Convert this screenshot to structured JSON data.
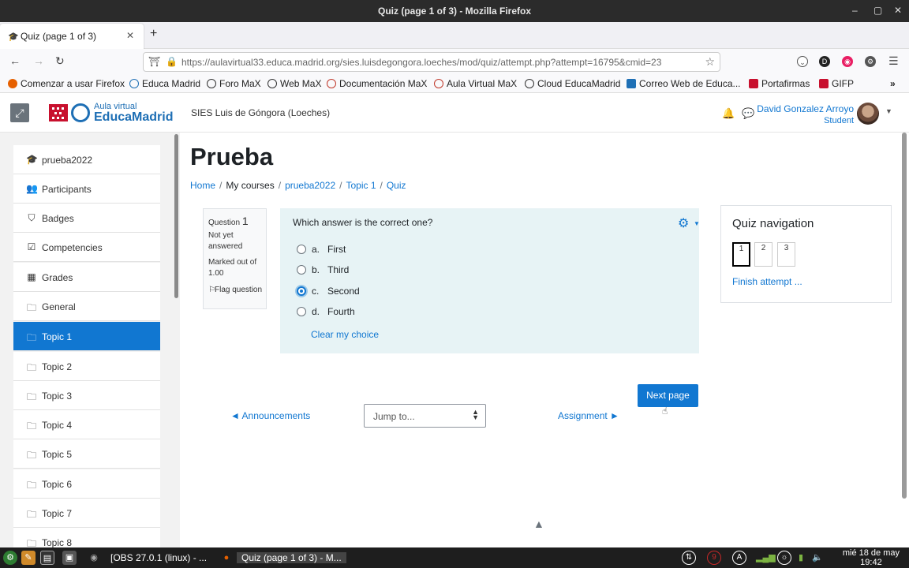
{
  "window": {
    "title": "Quiz (page 1 of 3) - Mozilla Firefox"
  },
  "browser": {
    "tab_title": "Quiz (page 1 of 3)",
    "url": "https://aulavirtual33.educa.madrid.org/sies.luisdegongora.loeches/mod/quiz/attempt.php?attempt=16795&cmid=23",
    "bookmarks": [
      {
        "label": "Comenzar a usar Firefox",
        "color": "#e66000"
      },
      {
        "label": "Educa Madrid",
        "color": "#1e6fb5"
      },
      {
        "label": "Foro MaX",
        "color": "#333333"
      },
      {
        "label": "Web MaX",
        "color": "#333333"
      },
      {
        "label": "Documentación MaX",
        "color": "#c0392b"
      },
      {
        "label": "Aula Virtual MaX",
        "color": "#c0392b"
      },
      {
        "label": "Cloud EducaMadrid",
        "color": "#333333"
      },
      {
        "label": "Correo Web de Educa...",
        "color": "#1e6fb5"
      },
      {
        "label": "Portafirmas",
        "color": "#c8102e"
      },
      {
        "label": "GIFP",
        "color": "#c8102e"
      }
    ]
  },
  "header": {
    "logo_small": "Aula virtual",
    "logo_big": "EducaMadrid",
    "site_name": "SIES Luis de Góngora (Loeches)",
    "user_name": "David Gonzalez Arroyo",
    "user_role": "Student"
  },
  "drawer": {
    "items": [
      {
        "label": "prueba2022",
        "icon": "graduation-cap-icon",
        "glyph": "🎓"
      },
      {
        "label": "Participants",
        "icon": "users-icon",
        "glyph": "👥"
      },
      {
        "label": "Badges",
        "icon": "shield-icon",
        "glyph": "⛉"
      },
      {
        "label": "Competencies",
        "icon": "check-square-icon",
        "glyph": "☑"
      },
      {
        "label": "Grades",
        "icon": "table-icon",
        "glyph": "▦"
      },
      {
        "label": "General",
        "icon": "folder-icon",
        "glyph": "🗀"
      },
      {
        "label": "Topic 1",
        "icon": "folder-icon",
        "glyph": "🗀",
        "active": true
      },
      {
        "label": "Topic 2",
        "icon": "folder-icon",
        "glyph": "🗀"
      },
      {
        "label": "Topic 3",
        "icon": "folder-icon",
        "glyph": "🗀"
      },
      {
        "label": "Topic 4",
        "icon": "folder-icon",
        "glyph": "🗀"
      },
      {
        "label": "Topic 5",
        "icon": "folder-icon",
        "glyph": "🗀"
      },
      {
        "label": "Topic 6",
        "icon": "folder-icon",
        "glyph": "🗀"
      },
      {
        "label": "Topic 7",
        "icon": "folder-icon",
        "glyph": "🗀"
      },
      {
        "label": "Topic 8",
        "icon": "folder-icon",
        "glyph": "🗀"
      }
    ]
  },
  "main": {
    "page_title": "Prueba",
    "breadcrumb": [
      "Home",
      "My courses",
      "prueba2022",
      "Topic 1",
      "Quiz"
    ],
    "question": {
      "label": "Question",
      "number": "1",
      "status": "Not yet answered",
      "marked_out_of": "Marked out of 1.00",
      "flag": "Flag question",
      "text": "Which answer is the correct one?",
      "answers": [
        {
          "letter": "a.",
          "text": "First",
          "checked": false
        },
        {
          "letter": "b.",
          "text": "Third",
          "checked": false
        },
        {
          "letter": "c.",
          "text": "Second",
          "checked": true
        },
        {
          "letter": "d.",
          "text": "Fourth",
          "checked": false
        }
      ],
      "clear": "Clear my choice"
    },
    "quiz_navigation": {
      "heading": "Quiz navigation",
      "pages": [
        "1",
        "2",
        "3"
      ],
      "current": "1",
      "finish": "Finish attempt ..."
    },
    "next_button": "Next page",
    "prev_activity": "◄ Announcements",
    "jump_placeholder": "Jump to...",
    "next_activity": "Assignment ►"
  },
  "taskbar": {
    "tasks": [
      "[OBS 27.0.1 (linux) - ...",
      "Quiz (page 1 of 3) - M..."
    ],
    "tray": [
      "9",
      "A"
    ],
    "clock_date": "mié 18 de may",
    "clock_time": "19:42"
  },
  "colors": {
    "accent": "#1177d1",
    "question_bg": "#e7f3f5",
    "brand_red": "#c8102e"
  }
}
